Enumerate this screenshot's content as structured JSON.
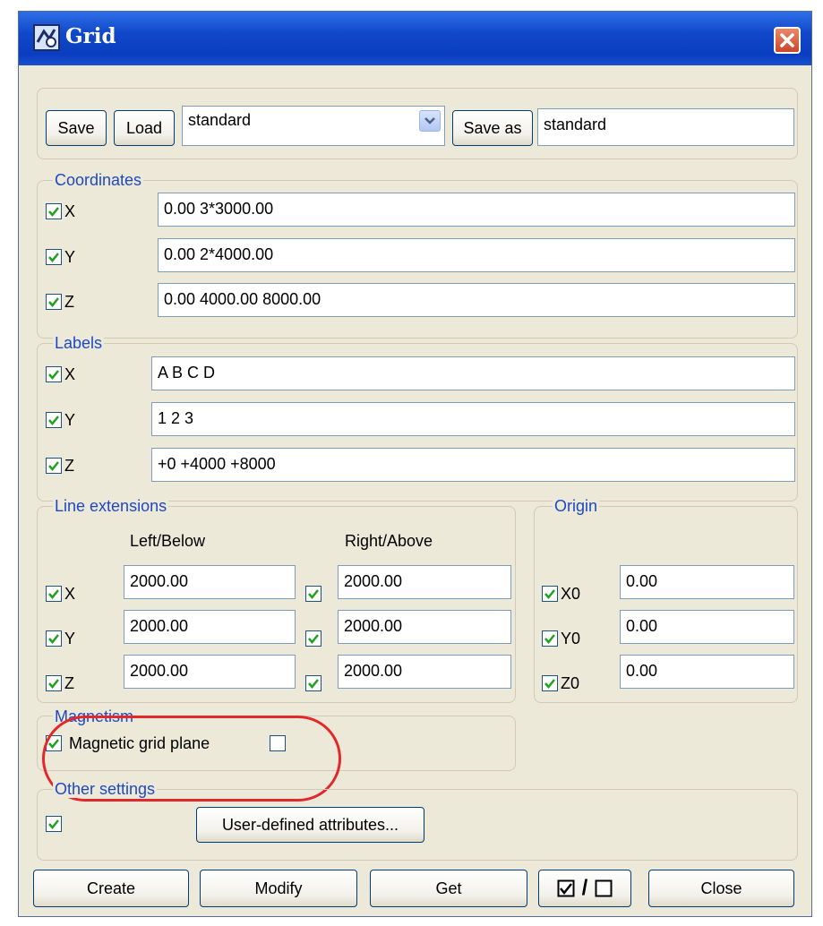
{
  "window": {
    "title": "Grid",
    "icon": "app-grid-icon",
    "close_icon": "close-icon"
  },
  "toolbar": {
    "save_label": "Save",
    "load_label": "Load",
    "preset_value": "standard",
    "save_as_label": "Save as",
    "save_as_value": "standard"
  },
  "coordinates": {
    "title": "Coordinates",
    "rows": [
      {
        "label": "X",
        "checked": true,
        "value": "0.00 3*3000.00"
      },
      {
        "label": "Y",
        "checked": true,
        "value": "0.00 2*4000.00"
      },
      {
        "label": "Z",
        "checked": true,
        "value": "0.00 4000.00 8000.00"
      }
    ]
  },
  "labels": {
    "title": "Labels",
    "rows": [
      {
        "label": "X",
        "checked": true,
        "value": "A B C D"
      },
      {
        "label": "Y",
        "checked": true,
        "value": "1 2 3"
      },
      {
        "label": "Z",
        "checked": true,
        "value": "+0 +4000 +8000"
      }
    ]
  },
  "line_extensions": {
    "title": "Line extensions",
    "left_header": "Left/Below",
    "right_header": "Right/Above",
    "rows": [
      {
        "label": "X",
        "checked": true,
        "left": "2000.00",
        "right_checked": true,
        "right": "2000.00"
      },
      {
        "label": "Y",
        "checked": true,
        "left": "2000.00",
        "right_checked": true,
        "right": "2000.00"
      },
      {
        "label": "Z",
        "checked": true,
        "left": "2000.00",
        "right_checked": true,
        "right": "2000.00"
      }
    ]
  },
  "origin": {
    "title": "Origin",
    "rows": [
      {
        "label": "X0",
        "checked": true,
        "value": "0.00"
      },
      {
        "label": "Y0",
        "checked": true,
        "value": "0.00"
      },
      {
        "label": "Z0",
        "checked": true,
        "value": "0.00"
      }
    ]
  },
  "magnetism": {
    "title": "Magnetism",
    "plane_label": "Magnetic grid plane",
    "plane_checked": true,
    "second_checked": false
  },
  "other_settings": {
    "title": "Other settings",
    "checked": true,
    "uda_button": "User-defined attributes..."
  },
  "footer": {
    "create": "Create",
    "modify": "Modify",
    "get": "Get",
    "toggle_all_slash": "/",
    "close": "Close"
  },
  "colors": {
    "title_bar": "#0a3dbf",
    "dialog_bg": "#ece9d8",
    "group_label": "#1f48c4",
    "check_mark": "#21a121",
    "highlight": "#e3282c"
  }
}
